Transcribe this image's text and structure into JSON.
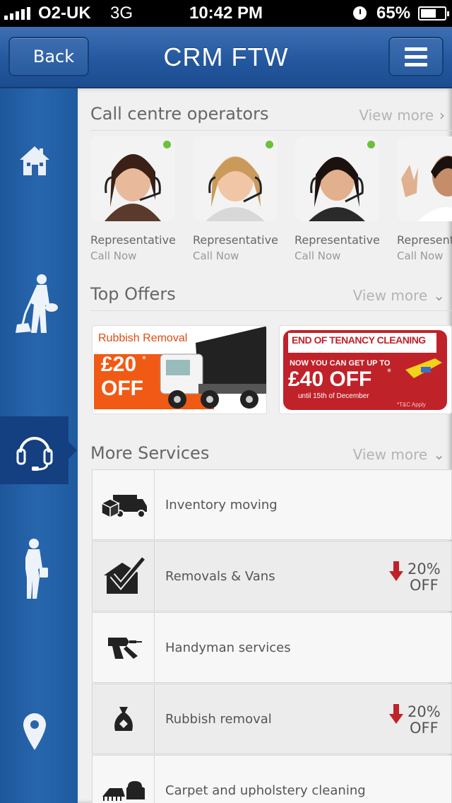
{
  "status": {
    "carrier": "O2-UK",
    "network": "3G",
    "time": "10:42 PM",
    "battery": "65%",
    "battery_fraction": 0.65
  },
  "nav": {
    "back_label": "Back",
    "title": "CRM FTW",
    "menu_icon": "menu-icon"
  },
  "sidebar": {
    "items": [
      {
        "icon": "home-icon",
        "active": false
      },
      {
        "icon": "cleaner-icon",
        "active": false
      },
      {
        "icon": "headset-icon",
        "active": true
      },
      {
        "icon": "businesswoman-icon",
        "active": false
      },
      {
        "icon": "location-pin-icon",
        "active": false
      }
    ]
  },
  "operators": {
    "heading": "Call centre operators",
    "view_more": "View more",
    "items": [
      {
        "name": "Representative",
        "action": "Call Now",
        "online": true
      },
      {
        "name": "Representative",
        "action": "Call Now",
        "online": true
      },
      {
        "name": "Representative",
        "action": "Call Now",
        "online": true
      },
      {
        "name": "Representative",
        "action": "Call Now",
        "online": false
      }
    ]
  },
  "offers": {
    "heading": "Top Offers",
    "view_more": "View more",
    "banner1": {
      "title": "Rubbish Removal",
      "amount": "£20",
      "star": "*",
      "off": "OFF"
    },
    "banner2": {
      "title": "END OF TENANCY CLEANING",
      "line1": "NOW YOU CAN GET UP TO",
      "amount": "£40 OFF",
      "star": "*",
      "until": "until 15th of December",
      "tc": "*T&C Apply"
    }
  },
  "services": {
    "heading": "More Services",
    "view_more": "View more",
    "items": [
      {
        "label": "Inventory moving",
        "icon": "truck-icon",
        "discount": null
      },
      {
        "label": "Removals & Vans",
        "icon": "house-check-icon",
        "discount": "20%",
        "discount_off": "OFF"
      },
      {
        "label": "Handyman services",
        "icon": "drill-icon",
        "discount": null
      },
      {
        "label": "Rubbish removal",
        "icon": "rubbish-bag-icon",
        "discount": "20%",
        "discount_off": "OFF"
      },
      {
        "label": "Carpet and upholstery cleaning",
        "icon": "sofa-icon",
        "discount": null
      }
    ]
  },
  "colors": {
    "brand_blue": "#24589f",
    "accent_orange": "#f05a14",
    "accent_red": "#c0222a",
    "online_green": "#6dc03a"
  }
}
